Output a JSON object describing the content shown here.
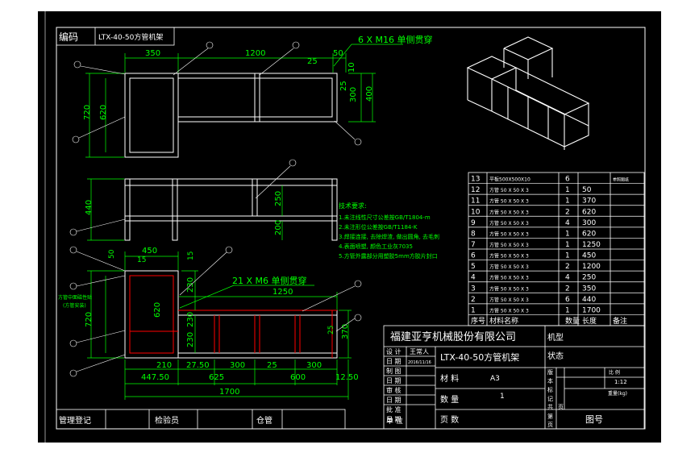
{
  "drawing": {
    "code_label": "编码",
    "code_value": "LTX-40-50方管机架",
    "notes_title": "技术要求:",
    "notes": [
      "1.未注线性尺寸公差按GB/T1804-m",
      "2.未注形位公差按GB/T1184-K",
      "3.焊接连接, 去除焊渣, 做出圆角, 去毛刺",
      "4.表面喷塑, 颜色工业灰7035",
      "5.方管外露部分用塑胶5mm方胶片封口"
    ],
    "bottom_labels": {
      "registry": "管理登记",
      "inspector": "检验员",
      "warehouse": "仓管"
    }
  },
  "dimensions": {
    "top": {
      "d350": "350",
      "d1200": "1200",
      "d25": "25",
      "d50": "50",
      "d10": "10",
      "d720": "720",
      "d620": "620",
      "d400": "400",
      "d300": "300",
      "d25v": "25",
      "callout": "6 X M16 单侧贯穿"
    },
    "middle": {
      "d440": "440",
      "d250": "250",
      "d200": "200"
    },
    "bottom": {
      "d450": "450",
      "d15": "15",
      "d50": "50",
      "d15b": "15",
      "d230a": "230",
      "d620": "620",
      "d720": "720",
      "d230b": "230",
      "d230c": "230",
      "d370": "370",
      "d25": "25",
      "d1250": "1250",
      "d210": "210",
      "d2750": "27.50",
      "d300a": "300",
      "d25b": "25",
      "d300b": "300",
      "d44750": "447.50",
      "d625": "625",
      "d600": "600",
      "d1250b": "12.50",
      "d1700": "1700",
      "callout": "21 X M6 单侧贯穿",
      "left_note1": "方管中面磁性贴",
      "left_note2": "(方管安装)"
    }
  },
  "bom": {
    "rows": [
      {
        "no": "13",
        "name": "平板500X500X10",
        "qty": "6",
        "len": "",
        "note": "参照图纸"
      },
      {
        "no": "12",
        "name": "方管 50 X 50 X 3",
        "qty": "1",
        "len": "50",
        "note": ""
      },
      {
        "no": "11",
        "name": "方管 50 X 50 X 3",
        "qty": "1",
        "len": "370",
        "note": ""
      },
      {
        "no": "10",
        "name": "方管 50 X 50 X 3",
        "qty": "2",
        "len": "620",
        "note": ""
      },
      {
        "no": "9",
        "name": "方管 50 X 50 X 3",
        "qty": "4",
        "len": "300",
        "note": ""
      },
      {
        "no": "8",
        "name": "方管 50 X 50 X 3",
        "qty": "1",
        "len": "620",
        "note": ""
      },
      {
        "no": "7",
        "name": "方管 50 X 50 X 3",
        "qty": "1",
        "len": "1250",
        "note": ""
      },
      {
        "no": "6",
        "name": "方管 50 X 50 X 3",
        "qty": "1",
        "len": "450",
        "note": ""
      },
      {
        "no": "5",
        "name": "方管 50 X 50 X 3",
        "qty": "2",
        "len": "1200",
        "note": ""
      },
      {
        "no": "4",
        "name": "方管 50 X 50 X 3",
        "qty": "4",
        "len": "250",
        "note": ""
      },
      {
        "no": "3",
        "name": "方管 50 X 50 X 3",
        "qty": "2",
        "len": "350",
        "note": ""
      },
      {
        "no": "2",
        "name": "方管 50 X 50 X 3",
        "qty": "6",
        "len": "440",
        "note": ""
      },
      {
        "no": "1",
        "name": "方管 50 X 50 X 3",
        "qty": "1",
        "len": "1700",
        "note": ""
      }
    ],
    "header": {
      "no": "序号",
      "name": "材料名称",
      "qty": "数量",
      "len": "长度",
      "note": "备注"
    }
  },
  "title_block": {
    "company": "福建亚亨机械股份有限公司",
    "model_label": "机型",
    "design_label": "设 计",
    "designer": "王常人",
    "date_label": "日 期",
    "date_value": "2016/11/16",
    "product_title": "LTX-40-50方管机架",
    "state_label": "状态",
    "draw_label": "制 图",
    "date2_label": "日 期",
    "material_label": "材 料",
    "material_value": "A3",
    "check_label": "审 核",
    "date3_label": "日 期",
    "qty_label": "数 量",
    "qty_value": "1",
    "approve_label": "批 准",
    "date4_label": "日 期",
    "unit_label": "单 位",
    "page_label": "页 数",
    "drawing_no_label": "图号",
    "scale_label": "比 例",
    "scale_value": "1:12",
    "weight_label": "重量(kg)",
    "r_labels": [
      "版",
      "本",
      "标",
      "记",
      "共",
      "页",
      "第",
      "页"
    ]
  },
  "colors": {
    "background": "#000000",
    "outer": "#ffffff",
    "line": "#ffffff",
    "dimension": "#00ff00",
    "hidden": "#ff0000",
    "label": "#ffff00"
  }
}
